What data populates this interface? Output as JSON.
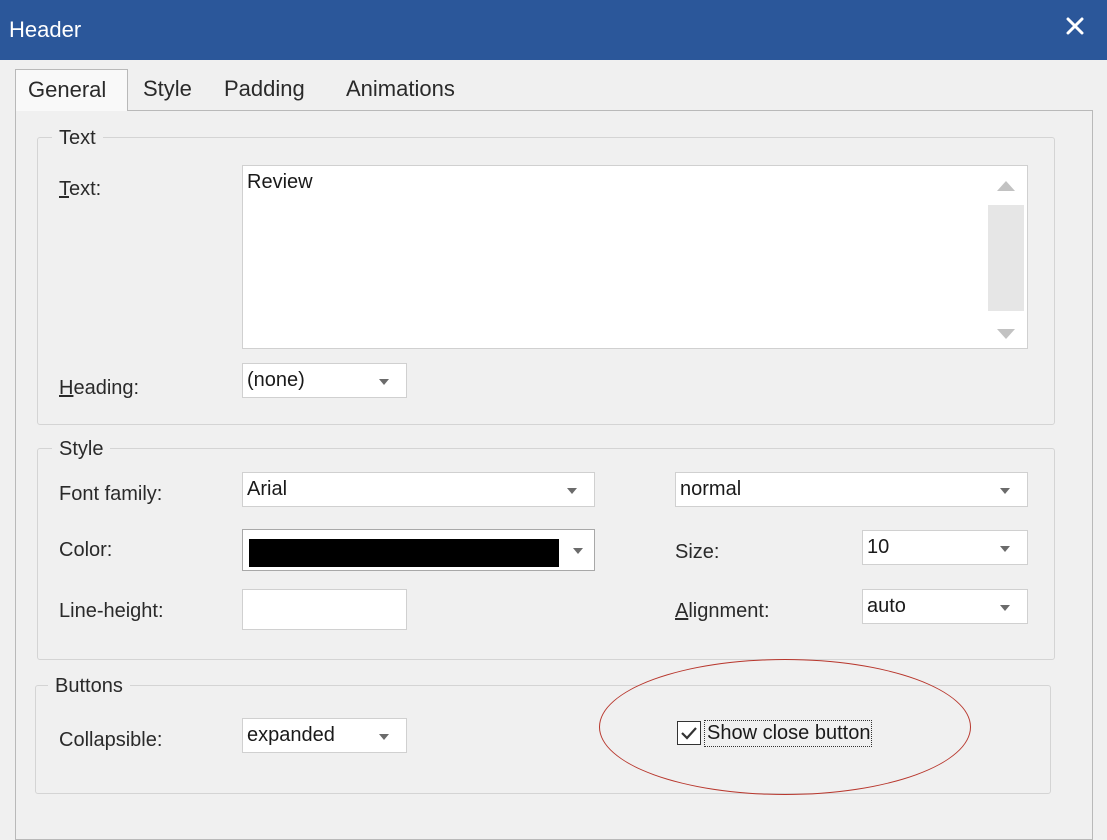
{
  "window": {
    "title": "Header",
    "close_icon": "close-icon",
    "titlebar_color": "#2b579a"
  },
  "tabs": [
    {
      "label": "General",
      "active": true
    },
    {
      "label": "Style",
      "active": false
    },
    {
      "label": "Padding",
      "active": false
    },
    {
      "label": "Animations",
      "active": false
    }
  ],
  "text_group": {
    "legend": "Text",
    "text_label_ul": "T",
    "text_label_rest": "ext:",
    "text_value": "Review",
    "heading_label_ul": "H",
    "heading_label_rest": "eading:",
    "heading_value": "(none)"
  },
  "style_group": {
    "legend": "Style",
    "font_family_label": "Font family:",
    "font_family_value": "Arial",
    "font_weight_value": "normal",
    "color_label": "Color:",
    "color_value": "#000000",
    "size_label": "Size:",
    "size_value": "10",
    "line_height_label": "Line-height:",
    "line_height_value": "",
    "alignment_label_ul": "A",
    "alignment_label_rest": "lignment:",
    "alignment_value": "auto"
  },
  "buttons_group": {
    "legend": "Buttons",
    "collapsible_label": "Collapsible:",
    "collapsible_value": "expanded",
    "show_close_checked": true,
    "show_close_label": "Show close button"
  },
  "annotation": {
    "shape": "ellipse",
    "color": "#b8372d"
  }
}
